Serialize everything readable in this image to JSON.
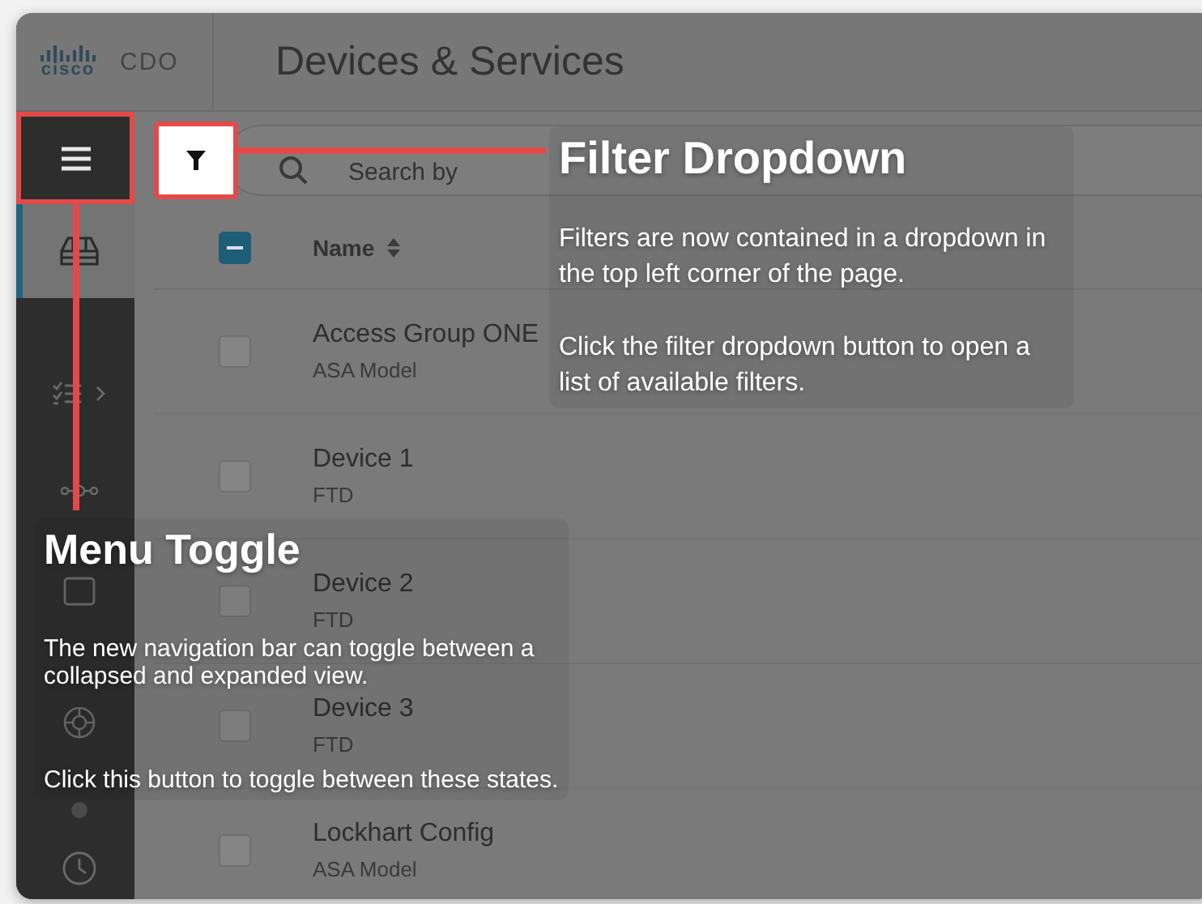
{
  "header": {
    "logo": "cisco",
    "product": "CDO",
    "title": "Devices & Services"
  },
  "sidebar": {
    "items": [
      {
        "kind": "devices",
        "selected": true
      },
      {
        "kind": "checklist",
        "selected": false
      },
      {
        "kind": "nodes",
        "selected": false
      },
      {
        "kind": "square",
        "selected": false
      },
      {
        "kind": "lifebuoy",
        "selected": false
      },
      {
        "kind": "dot",
        "selected": false
      },
      {
        "kind": "clock",
        "selected": false
      }
    ]
  },
  "search": {
    "placeholder": "Search by"
  },
  "table": {
    "select_all": {
      "indeterminate": true
    },
    "columns": [
      "Name"
    ],
    "rows": [
      {
        "name": "Access Group ONE",
        "type": "ASA Model",
        "checked": false
      },
      {
        "name": "Device 1",
        "type": "FTD",
        "checked": false
      },
      {
        "name": "Device 2",
        "type": "FTD",
        "checked": false
      },
      {
        "name": "Device 3",
        "type": "FTD",
        "checked": false
      },
      {
        "name": "Lockhart Config",
        "type": "ASA Model",
        "checked": false
      }
    ]
  },
  "callouts": [
    {
      "title": "Filter Dropdown",
      "paragraphs": [
        "Filters are now contained in a dropdown in the top left corner of the page.",
        "Click the filter dropdown button to open a list of available filters."
      ]
    },
    {
      "title": "Menu Toggle",
      "paragraphs": [
        "The new navigation bar can toggle between a collapsed and expanded view.",
        "Click this button to toggle between these states."
      ]
    }
  ]
}
